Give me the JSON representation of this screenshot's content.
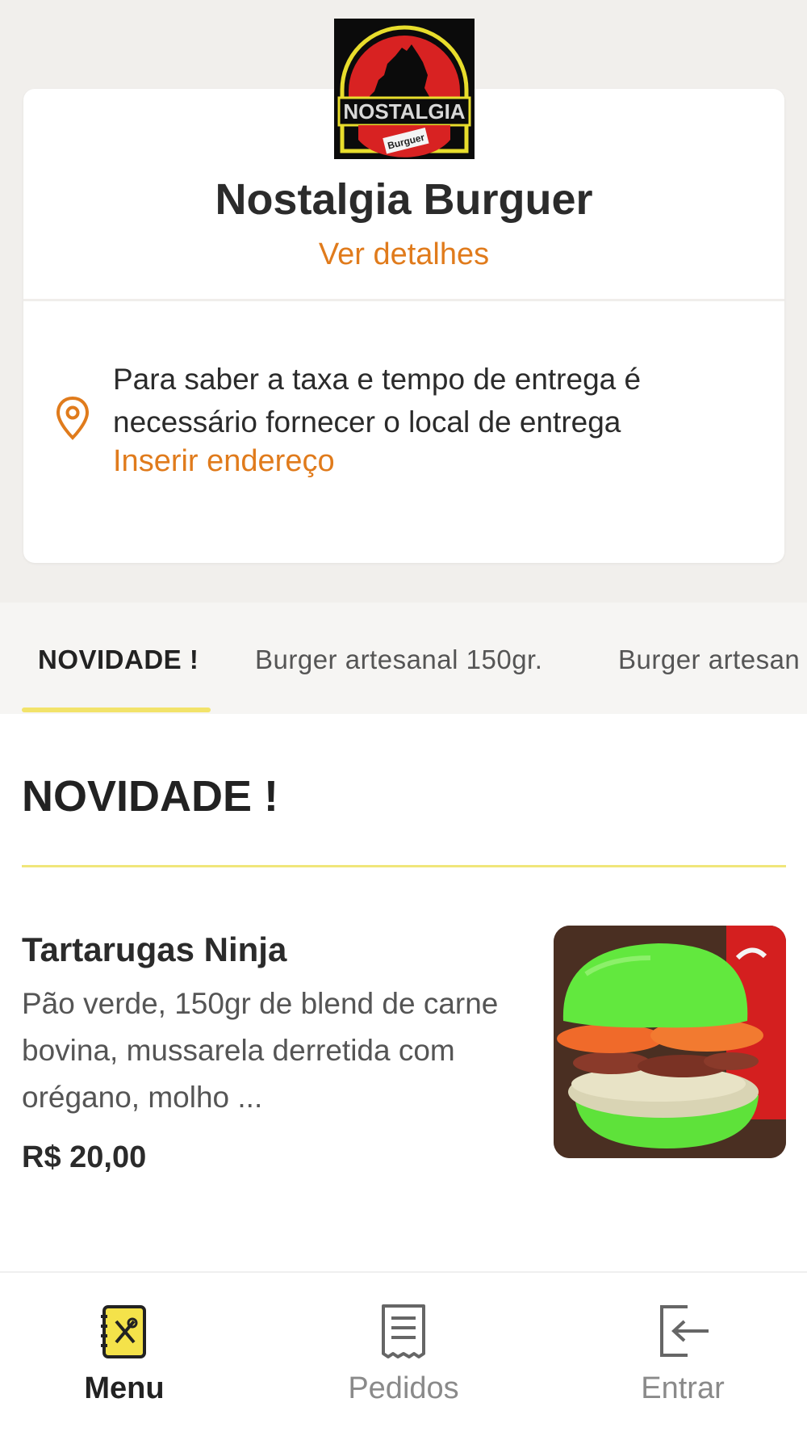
{
  "store": {
    "name": "Nostalgia Burguer",
    "details_link": "Ver detalhes",
    "logo_text": "NOSTALGIA",
    "logo_subtext": "Burguer"
  },
  "delivery": {
    "message": "Para saber a taxa e tempo de entrega é necessário fornecer o local de entrega",
    "address_link": "Inserir endereço",
    "icon": "location-pin-icon"
  },
  "tabs": [
    {
      "label": "NOVIDADE !",
      "active": true
    },
    {
      "label": "Burger artesanal 150gr.",
      "active": false
    },
    {
      "label": "Burger artesan",
      "active": false
    }
  ],
  "section": {
    "title": "NOVIDADE !"
  },
  "products": [
    {
      "name": "Tartarugas Ninja",
      "description": "Pão verde, 150gr de blend de carne bovina, mussarela derretida com orégano, molho ...",
      "price": "R$ 20,00"
    }
  ],
  "bottom_nav": [
    {
      "label": "Menu",
      "icon": "menu-book-icon",
      "active": true
    },
    {
      "label": "Pedidos",
      "icon": "receipt-icon",
      "active": false
    },
    {
      "label": "Entrar",
      "icon": "login-icon",
      "active": false
    }
  ],
  "colors": {
    "accent": "#e07b1c",
    "highlight": "#f2e36a",
    "background": "#f1efec"
  }
}
